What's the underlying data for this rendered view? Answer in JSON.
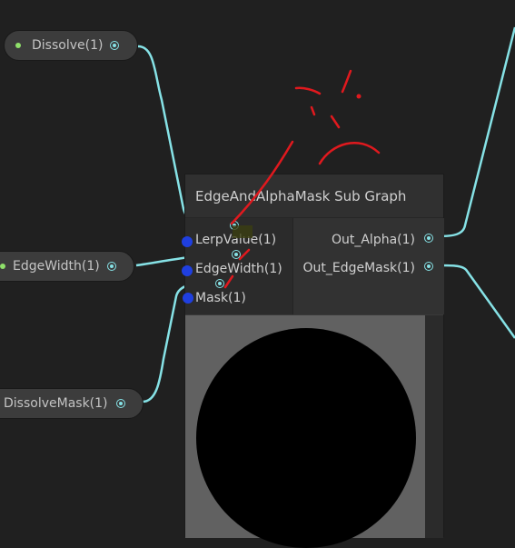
{
  "graph": {
    "property_nodes": [
      {
        "label": "Dissolve(1)"
      },
      {
        "label": "EdgeWidth(1)"
      },
      {
        "label": "DissolveMask(1)"
      }
    ],
    "subgraph_node": {
      "title": "EdgeAndAlphaMask Sub Graph",
      "inputs": [
        {
          "label": "LerpValue(1)"
        },
        {
          "label": "EdgeWidth(1)"
        },
        {
          "label": "Mask(1)"
        }
      ],
      "outputs": [
        {
          "label": "Out_Alpha(1)"
        },
        {
          "label": "Out_EdgeMask(1)"
        }
      ]
    }
  },
  "colors": {
    "canvas_bg": "#202020",
    "wire": "#86e2e6",
    "annotation": "#e0191e",
    "connection_marker": "#1f3fe0"
  }
}
